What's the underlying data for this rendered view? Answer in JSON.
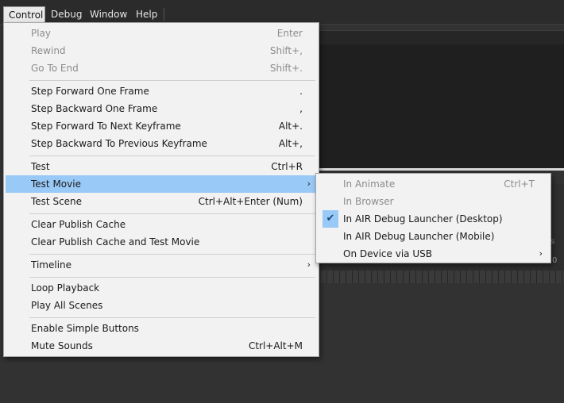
{
  "menubar": {
    "items": [
      "Control",
      "Debug",
      "Window",
      "Help"
    ]
  },
  "control_menu": {
    "items": [
      {
        "label": "Play",
        "shortcut": "Enter"
      },
      {
        "label": "Rewind",
        "shortcut": "Shift+,"
      },
      {
        "label": "Go To End",
        "shortcut": "Shift+."
      },
      {
        "label": "Step Forward One Frame",
        "shortcut": "."
      },
      {
        "label": "Step Backward One Frame",
        "shortcut": ","
      },
      {
        "label": "Step Forward To Next Keyframe",
        "shortcut": "Alt+."
      },
      {
        "label": "Step Backward To Previous Keyframe",
        "shortcut": "Alt+,"
      },
      {
        "label": "Test",
        "shortcut": "Ctrl+R"
      },
      {
        "label": "Test Movie",
        "arrow": "›"
      },
      {
        "label": "Test Scene",
        "shortcut": "Ctrl+Alt+Enter (Num)"
      },
      {
        "label": "Clear Publish Cache"
      },
      {
        "label": "Clear Publish Cache and Test Movie"
      },
      {
        "label": "Timeline",
        "arrow": "›"
      },
      {
        "label": "Loop Playback"
      },
      {
        "label": "Play All Scenes"
      },
      {
        "label": "Enable Simple Buttons"
      },
      {
        "label": "Mute Sounds",
        "shortcut": "Ctrl+Alt+M"
      }
    ]
  },
  "test_movie_submenu": {
    "items": [
      {
        "label": "In Animate",
        "shortcut": "Ctrl+T"
      },
      {
        "label": "In Browser"
      },
      {
        "label": "In AIR Debug Launcher (Desktop)",
        "check": "✔"
      },
      {
        "label": "In AIR Debug Launcher (Mobile)"
      },
      {
        "label": "On Device via USB",
        "arrow": "›"
      }
    ]
  },
  "background": {
    "edge_glyph_1": "0",
    "edge_glyph_2": "s"
  },
  "icons": {
    "checkmark": "check-icon",
    "submenu_arrow": "chevron-right-icon"
  },
  "colors": {
    "menu_bg": "#f2f2f2",
    "highlight": "#99c9f7",
    "app_bg": "#323232"
  }
}
